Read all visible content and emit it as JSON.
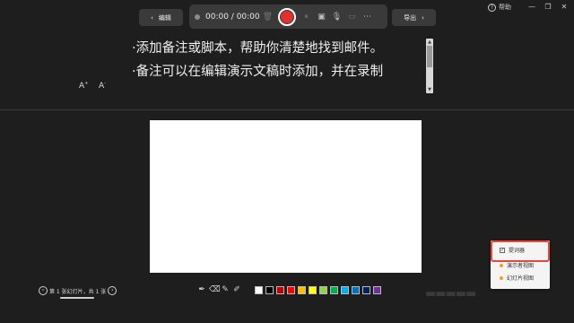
{
  "window": {
    "help_label": "帮助",
    "help_icon": "question-circle-icon",
    "min_icon": "minimize-icon",
    "restore_icon": "restore-icon",
    "close_icon": "close-icon"
  },
  "toolbar": {
    "edit_label": "编辑",
    "edit_icon": "chevron-left-icon",
    "export_label": "导出",
    "export_icon": "chevron-right-icon",
    "timer": "00:00 / 00:00",
    "icons": [
      "trash-icon",
      "record-icon",
      "pause-icon",
      "camera-off-icon",
      "microphone-icon",
      "screen-icon",
      "more-icon"
    ]
  },
  "notes": {
    "lines": [
      "·添加备注或脚本，帮助你清楚地找到邮件。",
      "·备注可以在编辑演示文稿时添加，并在录制"
    ],
    "font_increase": "A",
    "font_decrease": "A"
  },
  "slide_nav": {
    "text": "第 1 张幻灯片，共 1 张",
    "prev_icon": "chevron-left-icon",
    "next_icon": "chevron-right-icon"
  },
  "pen_tools": [
    "pen-icon",
    "eraser-icon",
    "highlighter-icon",
    "marker-icon"
  ],
  "colors": [
    "#ffffff",
    "#000000",
    "#c00000",
    "#ff0000",
    "#ffc000",
    "#ffff00",
    "#92d050",
    "#00b050",
    "#00b0f0",
    "#0070c0",
    "#002060",
    "#7030a0"
  ],
  "popup_menu": {
    "items": [
      {
        "label": "提词器",
        "checked": true,
        "marker": "#888888"
      },
      {
        "label": "演示者视图",
        "checked": false,
        "marker": "#f0a020"
      },
      {
        "label": "幻灯片视图",
        "checked": false,
        "marker": "#f0a020"
      }
    ],
    "highlight_color": "#e8473b"
  },
  "accent": {
    "record": "#e03131",
    "background": "#1e1e1e"
  }
}
